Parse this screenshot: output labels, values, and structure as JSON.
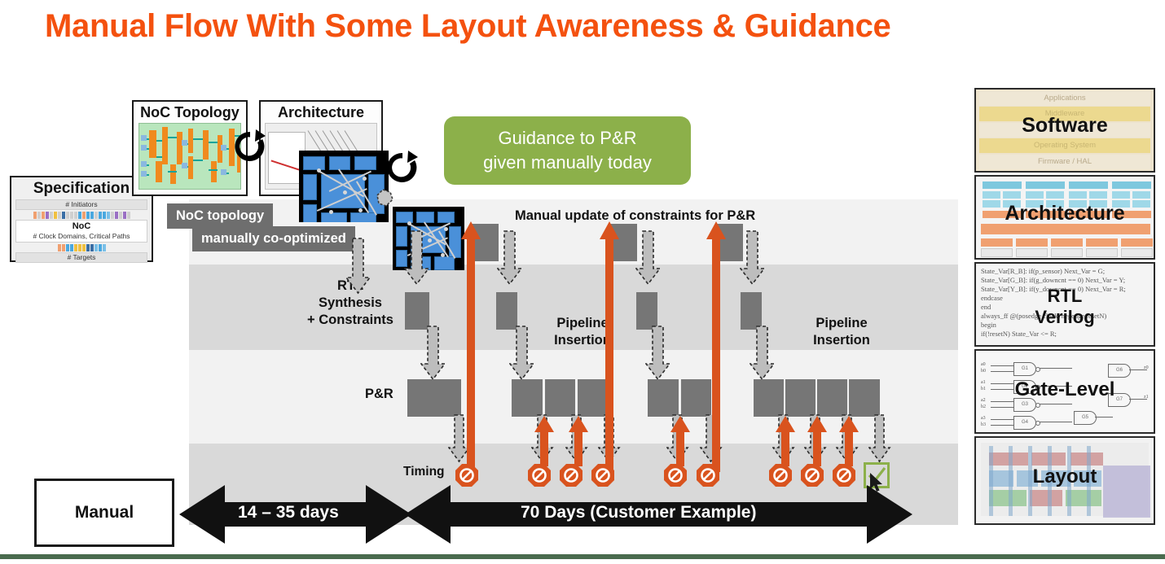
{
  "slide": {
    "title": "Manual Flow With Some Layout Awareness & Guidance",
    "title_color": "#f4510f",
    "accent_green": "#8cb04a",
    "accent_red": "#d9531e",
    "block_gray": "#767676",
    "bottom_rule_color": "#4a6b4e"
  },
  "inputs": {
    "specification": {
      "title": "Specification",
      "rows": [
        "# Initiators",
        "# Targets"
      ],
      "inner_title": "NoC",
      "inner_sub": "# Clock Domains, Critical Paths"
    },
    "noc_topology": {
      "title": "NoC Topology"
    },
    "architecture": {
      "title": "Architecture"
    }
  },
  "callouts": {
    "line1": "NoC topology",
    "line2": "manually co-optimized",
    "guidance_line1": "Guidance to P&R",
    "guidance_line2": "given manually today"
  },
  "flow": {
    "constraints_label": "Manual update of constraints for P&R",
    "rtl_label": "RTL\nSynthesis\n+ Constraints",
    "rtl_label_lines": [
      "RTL",
      "Synthesis",
      "+ Constraints"
    ],
    "pnr_label": "P&R",
    "pipeline_label_lines": [
      "Pipeline",
      "Insertion"
    ],
    "pipeline_label_1": "Pipeline Insertion",
    "pipeline_label_2": "Pipeline Insertion",
    "timing_label": "Timing",
    "timing_results": [
      "fail",
      "fail",
      "fail",
      "fail",
      "fail",
      "fail",
      "fail",
      "fail",
      "fail",
      "pass"
    ],
    "timing_fail_count": 9,
    "timing_pass_count": 1
  },
  "duration": {
    "mode_label": "Manual",
    "phase1": "14 – 35 days",
    "phase2": "70 Days (Customer Example)"
  },
  "abstraction_stack": [
    {
      "name": "Software",
      "sublayers": [
        "Applications",
        "Middleware",
        "Operating System",
        "Firmware / HAL"
      ]
    },
    {
      "name": "Architecture"
    },
    {
      "name": "RTL Verilog",
      "name_lines": [
        "RTL",
        "Verilog"
      ],
      "code": [
        "State_Var[R_B]: if(p_sensor)      Next_Var = G;",
        "State_Var[G_B]: if(g_downcnt == 0) Next_Var = Y;",
        "State_Var[Y_B]: if(y_downcnt == 0) Next_Var = R;",
        "endcase",
        "end",
        "always_ff @(posedge clock, negedge resetN)",
        "begin",
        "   if(!resetN) State_Var <= R;"
      ]
    },
    {
      "name": "Gate-Level",
      "gates": [
        "G1",
        "G2",
        "G3",
        "G4",
        "G5",
        "G6",
        "G7"
      ],
      "pins": [
        "a0",
        "b0",
        "a1",
        "b1",
        "a2",
        "b2",
        "a3",
        "b3",
        "z0",
        "z1"
      ]
    },
    {
      "name": "Layout"
    }
  ]
}
